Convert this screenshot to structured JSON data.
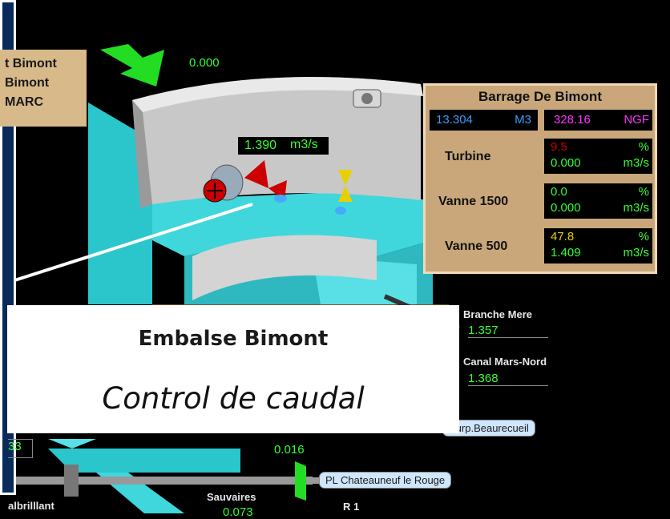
{
  "left_panel": {
    "lines": [
      "t Bimont",
      "Bimont",
      "MARC"
    ]
  },
  "top_flow": "0.000",
  "center_flow": {
    "value": "1.390",
    "unit": "m3/s"
  },
  "barrage": {
    "title": "Barrage De Bimont",
    "volume": {
      "value": "13.304",
      "unit": "M3"
    },
    "level": {
      "value": "328.16",
      "unit": "NGF"
    },
    "rows": [
      {
        "label": "Turbine",
        "pct": "9.5",
        "pct_unit": "%",
        "flow": "0.000",
        "flow_unit": "m3/s"
      },
      {
        "label": "Vanne 1500",
        "pct": "0.0",
        "pct_unit": "%",
        "flow": "0.000",
        "flow_unit": "m3/s"
      },
      {
        "label": "Vanne 500",
        "pct": "47.8",
        "pct_unit": "%",
        "flow": "1.409",
        "flow_unit": "m3/s"
      }
    ]
  },
  "branches": {
    "branche_mere": {
      "label": "Branche Mere",
      "value": "1.357"
    },
    "canal_mars_nord": {
      "label": "Canal Mars-Nord",
      "value": "1.368"
    }
  },
  "banner": {
    "title": "Embalse Bimont",
    "subtitle": "Control de caudal"
  },
  "bottom": {
    "surp": "Surp.Beaurecueil",
    "left_value": "33",
    "flow_value": "0.016",
    "pl_label": "PL Chateauneuf le  Rouge",
    "sauvaires": "Sauvaires",
    "sauvaires_value": "0.073",
    "r1": "R 1",
    "valbrillant": "albrilllant"
  },
  "colors": {
    "water": "#3fd6dc",
    "dam": "#c9c9c9",
    "panel": "#c9a77a",
    "value_green": "#33ff33",
    "turbine_pct": "#cc0000",
    "volume_blue": "#3a9cff",
    "level_magenta": "#ff33ff",
    "arrow_green": "#22dd22"
  }
}
